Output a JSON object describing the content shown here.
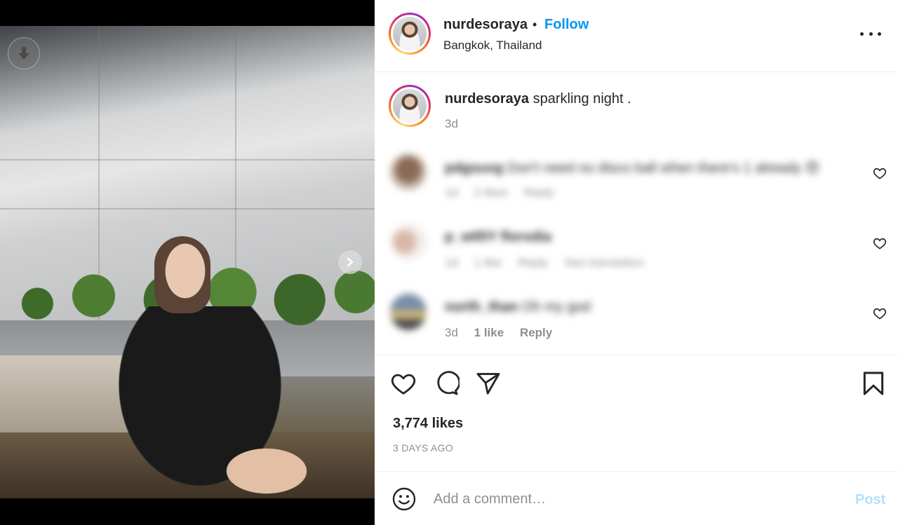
{
  "post": {
    "username": "nurdesoraya",
    "separator": "•",
    "follow_label": "Follow",
    "location": "Bangkok, Thailand",
    "more_icon": "more-horizontal-icon"
  },
  "caption": {
    "username": "nurdesoraya",
    "text": "sparkling night .",
    "time": "3d"
  },
  "comments": [
    {
      "username": "pdgsuvg",
      "text": "Don't need no disco ball when there's 1 already 😍",
      "time": "1d",
      "likes": "2 likes",
      "reply": "Reply"
    },
    {
      "username": "p_w05Y florsdia",
      "text": "",
      "time": "1d",
      "likes": "1 like",
      "reply": "Reply",
      "extra": "See translation"
    },
    {
      "username": "north_than",
      "text": "Oh my god",
      "time": "3d",
      "likes": "1 like",
      "reply": "Reply"
    }
  ],
  "actions": {
    "like_icon": "heart-icon",
    "comment_icon": "comment-icon",
    "share_icon": "paper-plane-icon",
    "save_icon": "bookmark-icon"
  },
  "likes": "3,774 likes",
  "date": "3 DAYS AGO",
  "composer": {
    "placeholder": "Add a comment…",
    "post_label": "Post",
    "emoji_icon": "smiley-icon"
  },
  "media": {
    "download_icon": "download-arrow-icon",
    "next_icon": "chevron-right-icon"
  },
  "colors": {
    "link_blue": "#0095f6",
    "post_disabled": "#b2dffc",
    "secondary_text": "#8e8e8e",
    "primary_text": "#262626"
  }
}
